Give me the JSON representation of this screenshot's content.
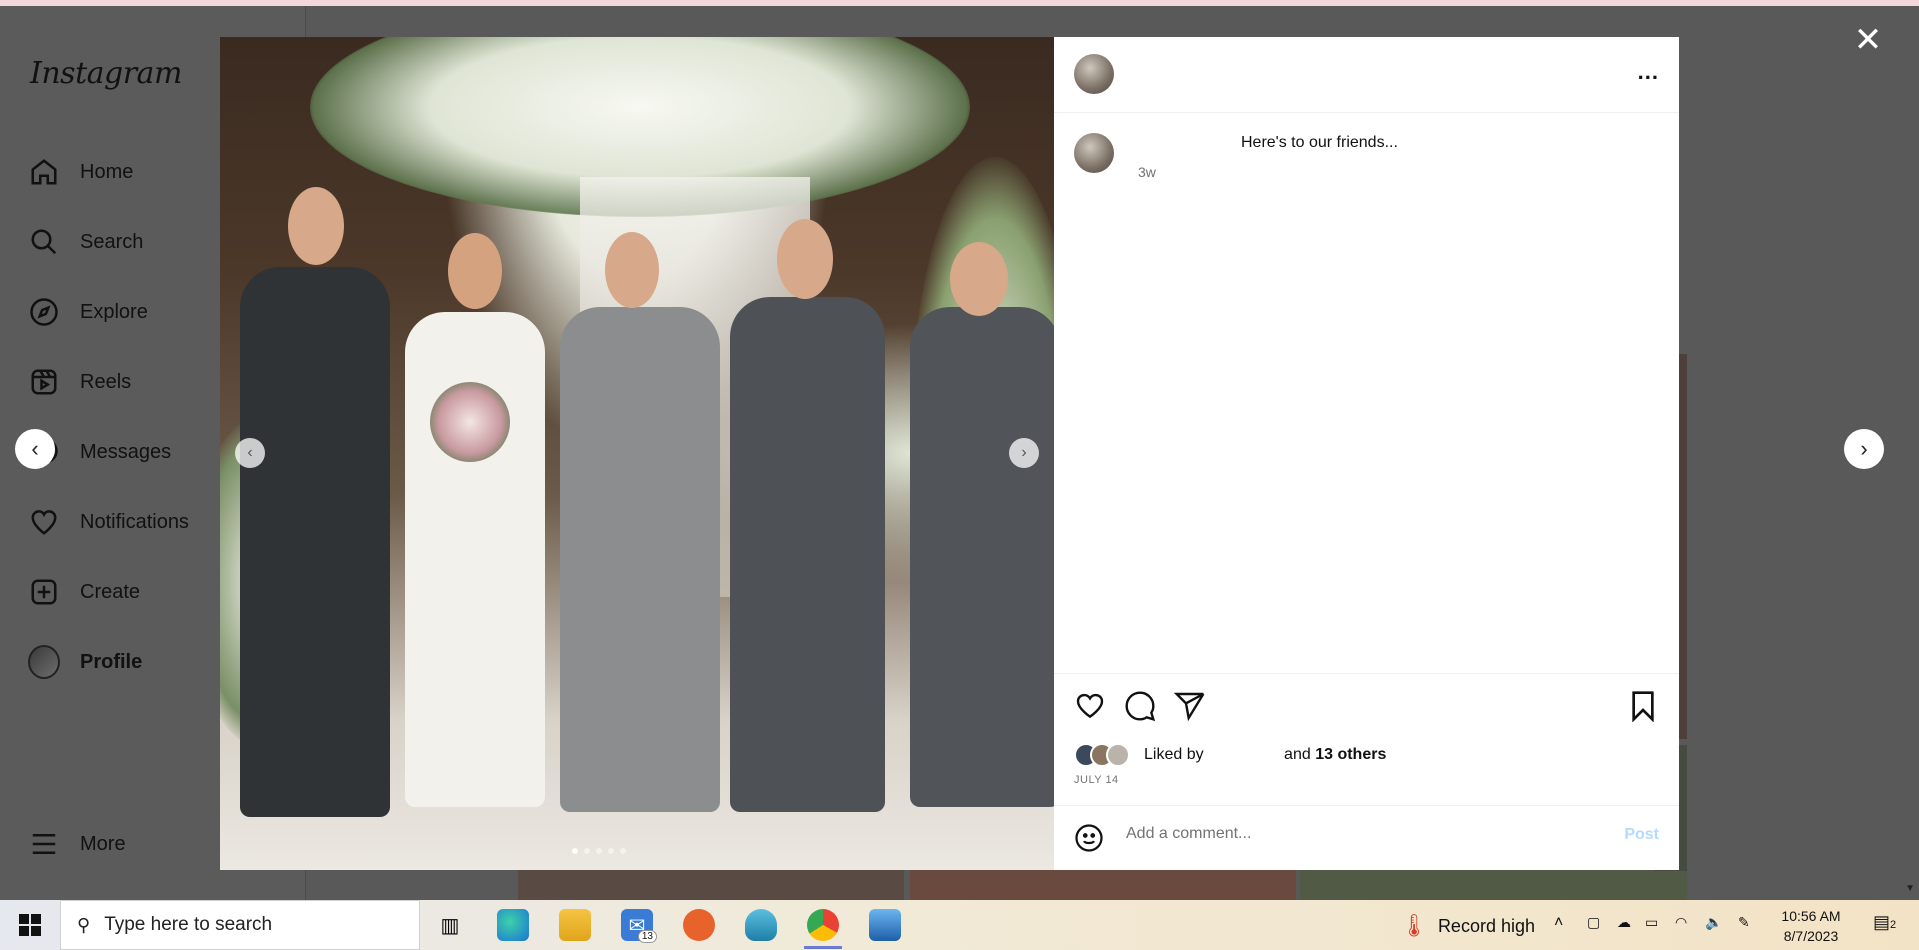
{
  "sidebar": {
    "logo": "Instagram",
    "items": [
      {
        "label": "Home",
        "icon": "home-icon"
      },
      {
        "label": "Search",
        "icon": "search-icon"
      },
      {
        "label": "Explore",
        "icon": "compass-icon"
      },
      {
        "label": "Reels",
        "icon": "reels-icon"
      },
      {
        "label": "Messages",
        "icon": "messenger-icon"
      },
      {
        "label": "Notifications",
        "icon": "heart-icon"
      },
      {
        "label": "Create",
        "icon": "plus-square-icon"
      },
      {
        "label": "Profile",
        "icon": "avatar"
      }
    ],
    "more_label": "More"
  },
  "post": {
    "caption": "Here's to our friends...",
    "time_ago": "3w",
    "liked_by_prefix": "Liked by",
    "liked_by_and": "and",
    "liked_by_others": "13 others",
    "date": "JULY 14",
    "comment_placeholder": "Add a comment...",
    "post_button": "Post",
    "more_options": "..."
  },
  "taskbar": {
    "search_placeholder": "Type here to search",
    "mail_badge": "13",
    "weather_text": "Record high",
    "time": "10:56 AM",
    "date": "8/7/2023",
    "notification_count": "2"
  },
  "colors": {
    "post_button": "#b3dbff",
    "overlay_bg": "#595959",
    "taskbar_active": "#6a7bd0"
  }
}
